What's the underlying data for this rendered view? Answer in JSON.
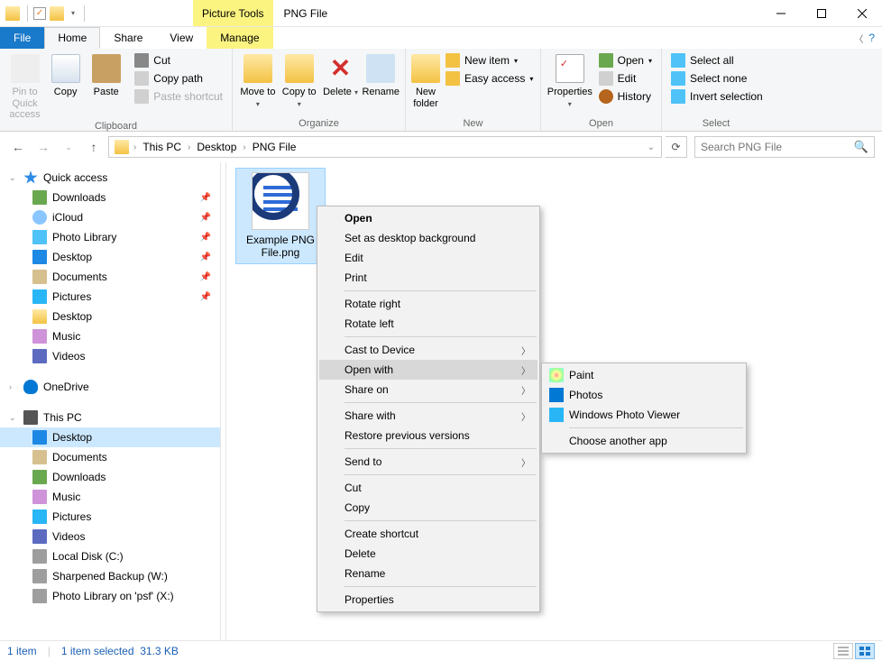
{
  "title": "PNG File",
  "pictureTools": "Picture Tools",
  "tabs": {
    "file": "File",
    "home": "Home",
    "share": "Share",
    "view": "View",
    "manage": "Manage"
  },
  "ribbon": {
    "clipboard": {
      "label": "Clipboard",
      "pin": "Pin to Quick access",
      "copy": "Copy",
      "paste": "Paste",
      "cut": "Cut",
      "copyPath": "Copy path",
      "pasteShortcut": "Paste shortcut"
    },
    "organize": {
      "label": "Organize",
      "moveTo": "Move to",
      "copyTo": "Copy to",
      "delete": "Delete",
      "rename": "Rename"
    },
    "new": {
      "label": "New",
      "newFolder": "New folder",
      "newItem": "New item",
      "easyAccess": "Easy access"
    },
    "open": {
      "label": "Open",
      "properties": "Properties",
      "open": "Open",
      "edit": "Edit",
      "history": "History"
    },
    "select": {
      "label": "Select",
      "selectAll": "Select all",
      "selectNone": "Select none",
      "invert": "Invert selection"
    }
  },
  "breadcrumb": {
    "segs": [
      "This PC",
      "Desktop",
      "PNG File"
    ]
  },
  "search": {
    "placeholder": "Search PNG File"
  },
  "sidebar": {
    "quickAccess": "Quick access",
    "items1": [
      "Downloads",
      "iCloud",
      "Photo Library",
      "Desktop",
      "Documents",
      "Pictures"
    ],
    "items2": [
      "Desktop",
      "Music",
      "Videos"
    ],
    "onedrive": "OneDrive",
    "thisPC": "This PC",
    "pcItems": [
      "Desktop",
      "Documents",
      "Downloads",
      "Music",
      "Pictures",
      "Videos",
      "Local Disk (C:)",
      "Sharpened Backup (W:)",
      "Photo Library on 'psf' (X:)"
    ]
  },
  "file": {
    "name": "Example PNG File.png"
  },
  "ctx": {
    "open": "Open",
    "setbg": "Set as desktop background",
    "edit": "Edit",
    "print": "Print",
    "rotR": "Rotate right",
    "rotL": "Rotate left",
    "cast": "Cast to Device",
    "openWith": "Open with",
    "shareOn": "Share on",
    "shareWith": "Share with",
    "restore": "Restore previous versions",
    "sendTo": "Send to",
    "cut": "Cut",
    "copy": "Copy",
    "shortcut": "Create shortcut",
    "delete": "Delete",
    "rename": "Rename",
    "props": "Properties"
  },
  "submenu": {
    "paint": "Paint",
    "photos": "Photos",
    "wpv": "Windows Photo Viewer",
    "choose": "Choose another app"
  },
  "status": {
    "items": "1 item",
    "selected": "1 item selected",
    "size": "31.3 KB"
  }
}
